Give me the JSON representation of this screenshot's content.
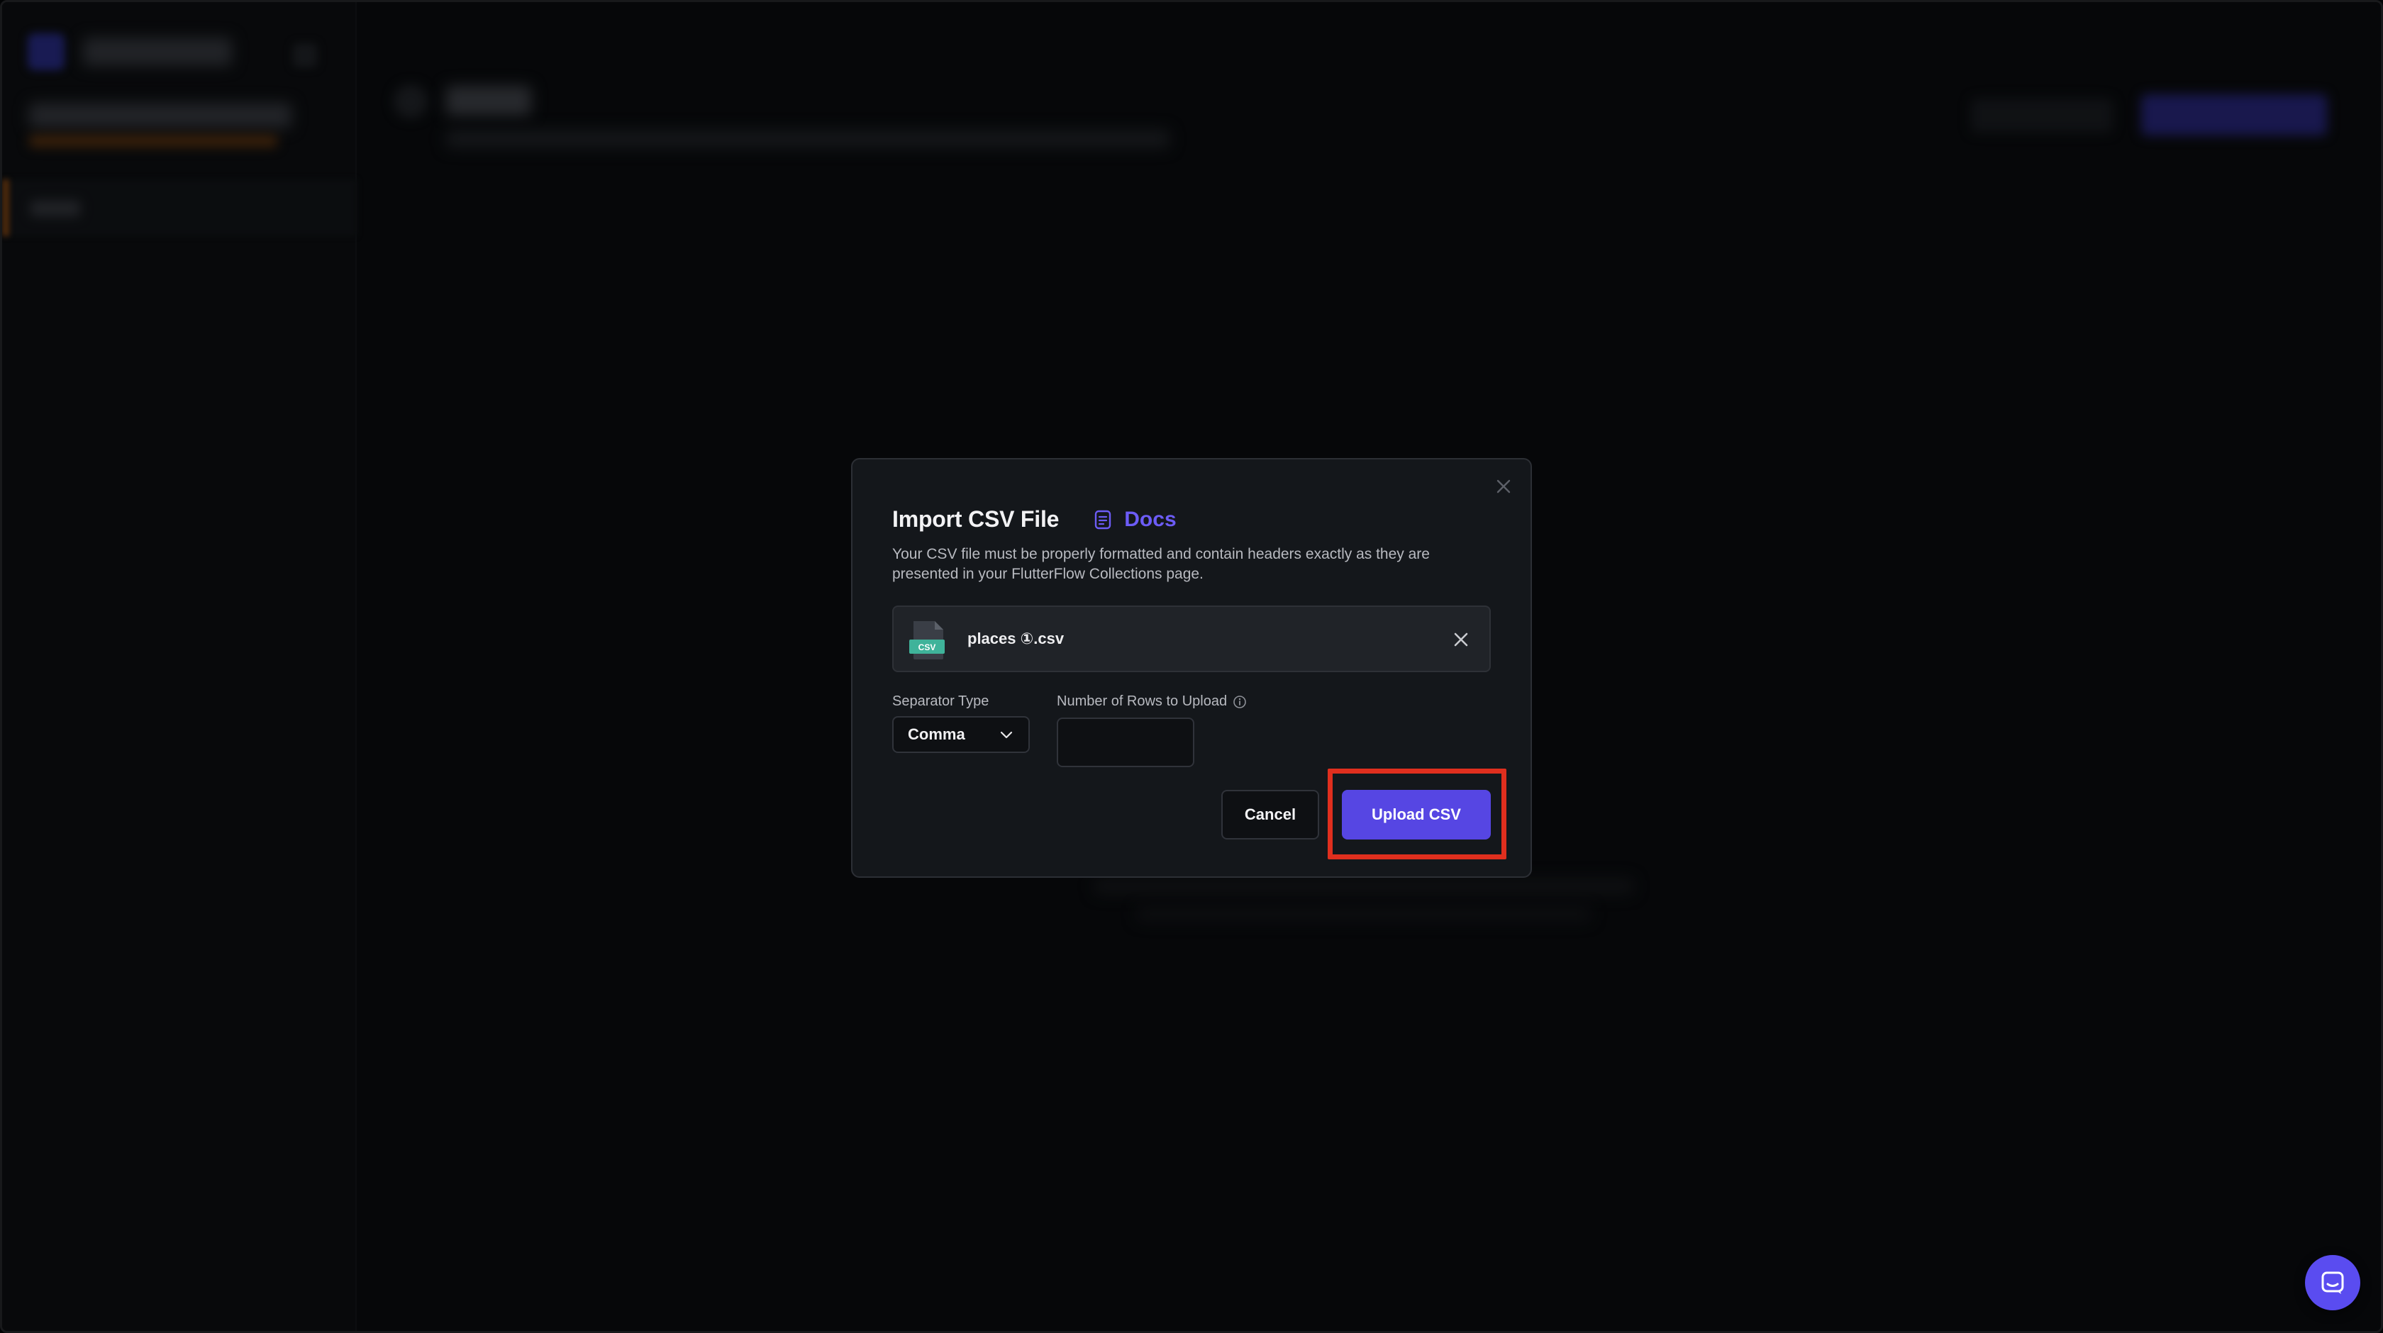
{
  "modal": {
    "title": "Import CSV File",
    "docs_label": "Docs",
    "description": "Your CSV file must be properly formatted and contain headers exactly as they are presented in your FlutterFlow Collections page.",
    "file": {
      "name": "places ①.csv",
      "icon_badge": "CSV",
      "icon": "csv-file-icon"
    },
    "separator": {
      "label": "Separator Type",
      "value": "Comma"
    },
    "rows_to_upload": {
      "label": "Number of Rows to Upload",
      "value": ""
    },
    "cancel_label": "Cancel",
    "upload_label": "Upload CSV"
  },
  "colors": {
    "accent": "#5646e3",
    "docs_link": "#6c5cf6",
    "highlight": "#e02f1e",
    "csv_badge": "#3fb39a"
  },
  "icons": {
    "close": "close-icon",
    "docs": "document-icon",
    "remove_file": "close-icon",
    "chevron": "chevron-down-icon",
    "info": "info-icon",
    "chat": "chat-bubble-icon"
  }
}
